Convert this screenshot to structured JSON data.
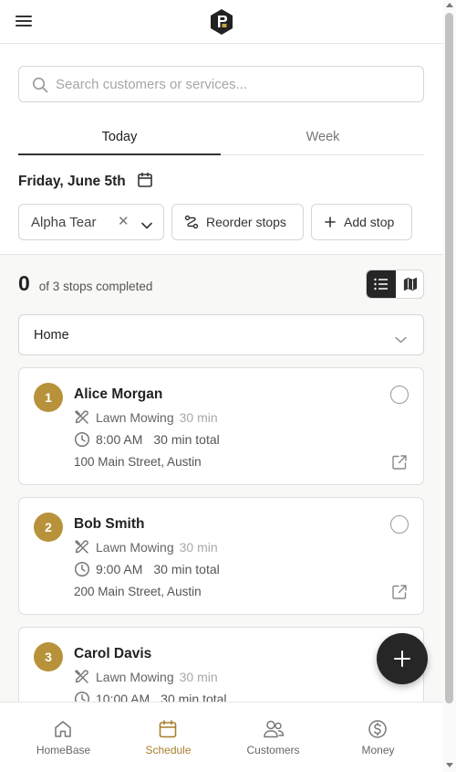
{
  "header": {
    "menu_icon": "hamburger-icon",
    "logo_icon": "app-logo"
  },
  "search": {
    "placeholder": "Search customers or services..."
  },
  "tabs": [
    {
      "label": "Today",
      "active": true
    },
    {
      "label": "Week",
      "active": false
    }
  ],
  "date": {
    "label": "Friday, June 5th",
    "icon": "calendar-icon"
  },
  "team_select": {
    "value": "Alpha Tear",
    "clear_icon": "close-icon",
    "dropdown_icon": "chevron-down-icon"
  },
  "actions": {
    "reorder_label": "Reorder stops",
    "add_label": "Add stop"
  },
  "progress": {
    "completed": "0",
    "text": "of 3 stops completed"
  },
  "view_toggle": {
    "active": "list",
    "options": [
      "list-icon",
      "map-icon"
    ]
  },
  "start_location": {
    "value": "Home"
  },
  "stops": [
    {
      "number": "1",
      "name": "Alice Morgan",
      "service": "Lawn Mowing",
      "service_duration": "30 min",
      "time": "8:00 AM",
      "total": "30 min total",
      "address": "100 Main Street, Austin",
      "completed": false
    },
    {
      "number": "2",
      "name": "Bob Smith",
      "service": "Lawn Mowing",
      "service_duration": "30 min",
      "time": "9:00 AM",
      "total": "30 min total",
      "address": "200 Main Street, Austin",
      "completed": false
    },
    {
      "number": "3",
      "name": "Carol Davis",
      "service": "Lawn Mowing",
      "service_duration": "30 min",
      "time": "10:00 AM",
      "total": "30 min total",
      "address": "",
      "completed": false
    }
  ],
  "fab": {
    "icon": "plus-icon"
  },
  "bottom_nav": [
    {
      "label": "HomeBase",
      "icon": "home-icon",
      "active": false
    },
    {
      "label": "Schedule",
      "icon": "calendar-icon",
      "active": true
    },
    {
      "label": "Customers",
      "icon": "users-icon",
      "active": false
    },
    {
      "label": "Money",
      "icon": "dollar-icon",
      "active": false
    }
  ],
  "colors": {
    "accent": "#b8923a",
    "active_nav": "#a77f2e",
    "dark": "#262626"
  }
}
